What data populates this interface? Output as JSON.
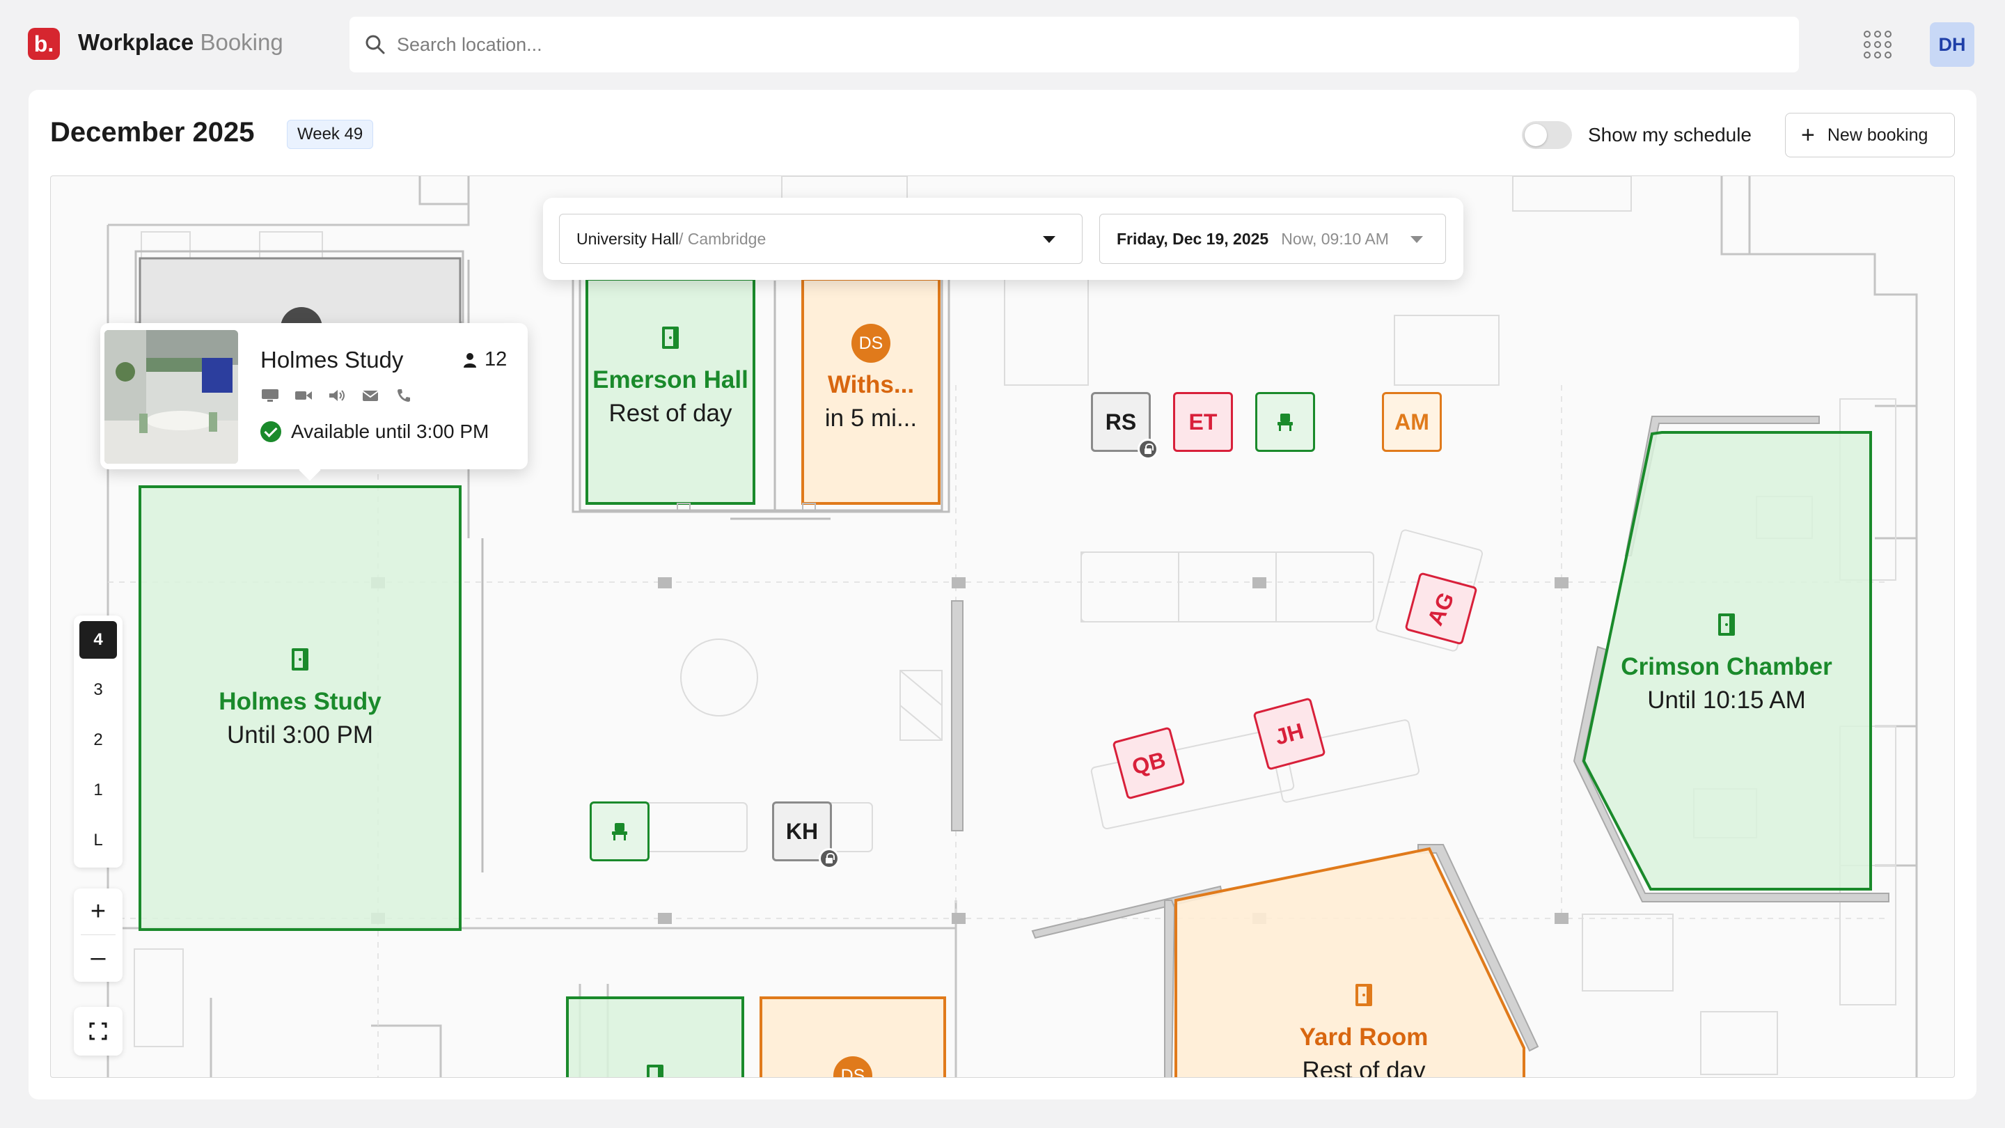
{
  "header": {
    "logo": "b.",
    "app_name": "Workplace",
    "app_name_sub": "Booking",
    "search_placeholder": "Search location...",
    "user_initials": "DH"
  },
  "toolbar": {
    "month": "December 2025",
    "week": "Week 49",
    "show_schedule_label": "Show my schedule",
    "show_schedule_on": false,
    "new_booking_label": "New booking"
  },
  "selector": {
    "building": "University Hall",
    "city": " / Cambridge",
    "date": "Friday, Dec 19, 2025",
    "time": "Now, 09:10 AM"
  },
  "popup": {
    "title": "Holmes Study",
    "capacity": "12",
    "availability": "Available until 3:00 PM",
    "amenities": [
      "display-icon",
      "video-camera-icon",
      "speaker-icon",
      "mail-icon",
      "phone-icon"
    ]
  },
  "rooms": [
    {
      "name": "Holmes Study",
      "status": "Until 3:00 PM",
      "state": "available"
    },
    {
      "name": "Emerson Hall",
      "status": "Rest of day",
      "state": "available"
    },
    {
      "name": "Withs...",
      "status": "in 5 mi...",
      "state": "upcoming",
      "avatar": "DS"
    },
    {
      "name": "Crimson Chamber",
      "status": "Until 10:15 AM",
      "state": "available"
    },
    {
      "name": "Yard Room",
      "status": "Rest of day",
      "state": "upcoming"
    },
    {
      "name": "",
      "status": "",
      "state": "available"
    },
    {
      "name": "",
      "status": "",
      "state": "upcoming",
      "avatar": "DS"
    }
  ],
  "desks": [
    {
      "initials": "RS",
      "state": "locked"
    },
    {
      "initials": "ET",
      "state": "booked"
    },
    {
      "initials": "",
      "state": "available"
    },
    {
      "initials": "AM",
      "state": "upcoming"
    },
    {
      "initials": "AG",
      "state": "booked"
    },
    {
      "initials": "JH",
      "state": "booked"
    },
    {
      "initials": "QB",
      "state": "booked"
    },
    {
      "initials": "",
      "state": "available"
    },
    {
      "initials": "KH",
      "state": "locked"
    }
  ],
  "floors": [
    "4",
    "3",
    "2",
    "1",
    "L"
  ],
  "active_floor": "4",
  "colors": {
    "brand": "#d6262f",
    "available": "#1a8a2b",
    "upcoming": "#e07a1b",
    "booked": "#d8203a"
  }
}
